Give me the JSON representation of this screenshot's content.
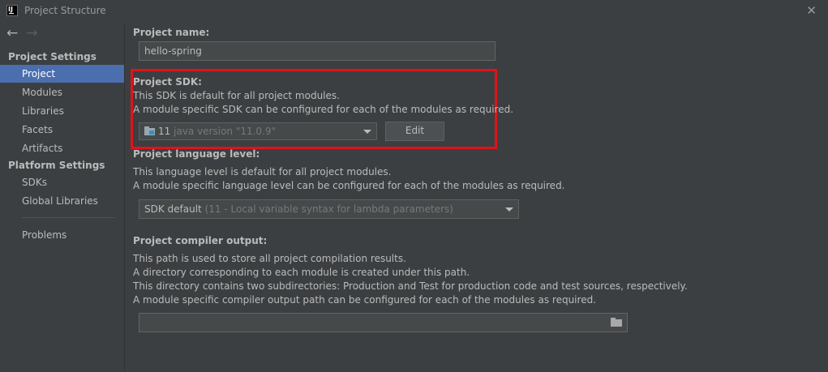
{
  "window": {
    "title": "Project Structure",
    "app_icon": "IJ"
  },
  "sidebar": {
    "project_settings_header": "Project Settings",
    "project_items": [
      "Project",
      "Modules",
      "Libraries",
      "Facets",
      "Artifacts"
    ],
    "platform_settings_header": "Platform Settings",
    "platform_items": [
      "SDKs",
      "Global Libraries"
    ],
    "problems": "Problems",
    "selected": "Project"
  },
  "project_name": {
    "label": "Project name:",
    "value": "hello-spring"
  },
  "project_sdk": {
    "label": "Project SDK:",
    "desc1": "This SDK is default for all project modules.",
    "desc2": "A module specific SDK can be configured for each of the modules as required.",
    "selected_value": "11",
    "selected_detail": "java version \"11.0.9\"",
    "edit_button": "Edit"
  },
  "language_level": {
    "label": "Project language level:",
    "desc1": "This language level is default for all project modules.",
    "desc2": "A module specific language level can be configured for each of the modules as required.",
    "selected_value": "SDK default",
    "selected_detail": "(11 - Local variable syntax for lambda parameters)"
  },
  "compiler_output": {
    "label": "Project compiler output:",
    "desc1": "This path is used to store all project compilation results.",
    "desc2": "A directory corresponding to each module is created under this path.",
    "desc3": "This directory contains two subdirectories: Production and Test for production code and test sources, respectively.",
    "desc4": "A module specific compiler output path can be configured for each of the modules as required.",
    "path_value": ""
  },
  "colors": {
    "highlight": "#e0121b",
    "selection": "#4b6eaf"
  }
}
